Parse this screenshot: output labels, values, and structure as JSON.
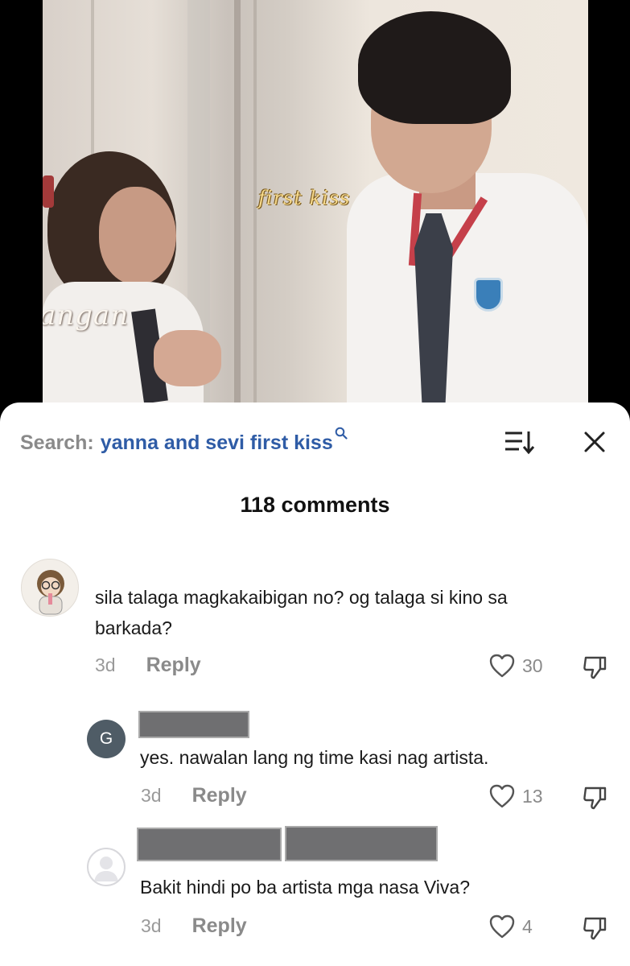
{
  "video": {
    "overlay_text_kiss": "first kiss",
    "overlay_text_name": "angan"
  },
  "search": {
    "prefix": "Search:",
    "query": "yanna and sevi first kiss",
    "icon": "search-icon"
  },
  "toolbar": {
    "sort_icon": "sort-icon",
    "close_icon": "close-icon"
  },
  "comments_count": "118 comments",
  "comments": [
    {
      "avatar": "illustrated-avatar",
      "text": "sila talaga magkakaibigan no? og talaga si kino sa barkada?",
      "time": "3d",
      "reply_label": "Reply",
      "likes": "30"
    },
    {
      "avatar_letter": "G",
      "text": "yes. nawalan lang ng time kasi nag artista.",
      "time": "3d",
      "reply_label": "Reply",
      "likes": "13"
    },
    {
      "avatar": "default-avatar",
      "text": "Bakit hindi po ba artista mga nasa Viva?",
      "time": "3d",
      "reply_label": "Reply",
      "likes": "4"
    }
  ],
  "colors": {
    "query_blue": "#2f5ca6",
    "muted_gray": "#8a8a8a",
    "avatar_g": "#4f5c66"
  }
}
